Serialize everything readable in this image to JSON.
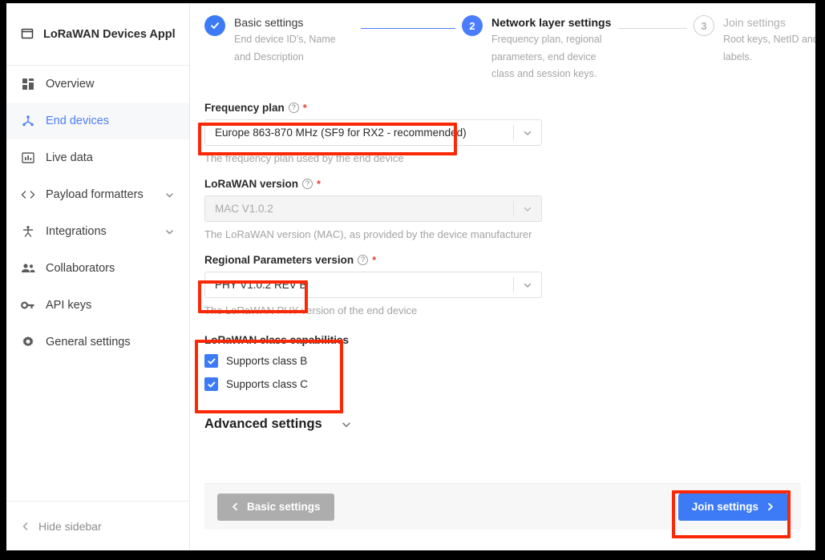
{
  "sidebar": {
    "app_title": "LoRaWAN Devices Applica…",
    "app_icon": "window-icon",
    "items": [
      {
        "label": "Overview",
        "icon": "grid-icon",
        "active": false,
        "chevron": false
      },
      {
        "label": "End devices",
        "icon": "device-icon",
        "active": true,
        "chevron": false
      },
      {
        "label": "Live data",
        "icon": "chart-icon",
        "active": false,
        "chevron": false
      },
      {
        "label": "Payload formatters",
        "icon": "code-icon",
        "active": false,
        "chevron": true
      },
      {
        "label": "Integrations",
        "icon": "puzzle-icon",
        "active": false,
        "chevron": true
      },
      {
        "label": "Collaborators",
        "icon": "people-icon",
        "active": false,
        "chevron": false
      },
      {
        "label": "API keys",
        "icon": "key-icon",
        "active": false,
        "chevron": false
      },
      {
        "label": "General settings",
        "icon": "gear-icon",
        "active": false,
        "chevron": false
      }
    ],
    "hide_sidebar": "Hide sidebar"
  },
  "stepper": {
    "steps": [
      {
        "state": "done",
        "marker": "check-icon",
        "title": "Basic settings",
        "description": "End device ID's, Name and Description"
      },
      {
        "state": "current",
        "marker": "2",
        "title": "Network layer settings",
        "description": "Frequency plan, regional parameters, end device class and session keys."
      },
      {
        "state": "todo",
        "marker": "3",
        "title": "Join settings",
        "description": "Root keys, NetID and kek labels."
      }
    ]
  },
  "form": {
    "frequency_plan": {
      "label": "Frequency plan",
      "required": "*",
      "value": "Europe 863-870 MHz (SF9 for RX2 - recommended)",
      "help": "The frequency plan used by the end device",
      "disabled": false
    },
    "lorawan_version": {
      "label": "LoRaWAN version",
      "required": "*",
      "value": "MAC V1.0.2",
      "help": "The LoRaWAN version (MAC), as provided by the device manufacturer",
      "disabled": true
    },
    "regional_parameters": {
      "label": "Regional Parameters version",
      "required": "*",
      "value": "PHY V1.0.2 REV B",
      "help": "The LoRaWAN PHY version of the end device",
      "disabled": false
    },
    "class_capabilities": {
      "title": "LoRaWAN class capabilities",
      "options": [
        {
          "label": "Supports class B",
          "checked": true
        },
        {
          "label": "Supports class C",
          "checked": true
        }
      ]
    },
    "advanced_settings": {
      "label": "Advanced settings",
      "chevron": "chevron-down-icon"
    }
  },
  "footer": {
    "back_button": "Basic settings",
    "next_button": "Join settings"
  },
  "colors": {
    "accent": "#3c7bf5",
    "link": "#4a7dfc",
    "annotation": "#fa2806",
    "required": "#e8403a",
    "secondary_button": "#adadad"
  }
}
